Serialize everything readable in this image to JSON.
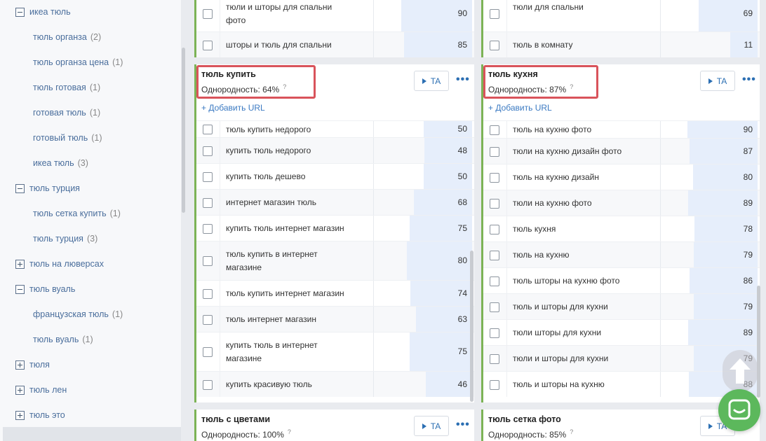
{
  "sidebar": {
    "items": [
      {
        "type": "parent",
        "state": "minus",
        "label": "икеа тюль",
        "count": ""
      },
      {
        "type": "child",
        "label": "тюль органза",
        "count": "(2)"
      },
      {
        "type": "child",
        "label": "тюль органза цена",
        "count": "(1)"
      },
      {
        "type": "child",
        "label": "тюль готовая",
        "count": "(1)"
      },
      {
        "type": "child",
        "label": "готовая тюль",
        "count": "(1)"
      },
      {
        "type": "child",
        "label": "готовый тюль",
        "count": "(1)"
      },
      {
        "type": "child",
        "label": "икеа тюль",
        "count": "(3)"
      },
      {
        "type": "parent",
        "state": "minus",
        "label": "тюль турция",
        "count": ""
      },
      {
        "type": "child",
        "label": "тюль сетка купить",
        "count": "(1)"
      },
      {
        "type": "child",
        "label": "тюль турция",
        "count": "(3)"
      },
      {
        "type": "parent",
        "state": "plus",
        "label": "тюль на люверсах",
        "count": ""
      },
      {
        "type": "parent",
        "state": "minus",
        "label": "тюль вуаль",
        "count": ""
      },
      {
        "type": "child",
        "label": "французская тюль",
        "count": "(1)"
      },
      {
        "type": "child",
        "label": "тюль вуаль",
        "count": "(1)"
      },
      {
        "type": "parent",
        "state": "plus",
        "label": "тюля",
        "count": ""
      },
      {
        "type": "parent",
        "state": "plus",
        "label": "тюль лен",
        "count": ""
      },
      {
        "type": "parent",
        "state": "plus",
        "label": "тюль это",
        "count": ""
      }
    ]
  },
  "common": {
    "ta_label": "TA",
    "add_url": "+ Добавить URL",
    "more": "•••",
    "hint": "?"
  },
  "top_left": {
    "rows": [
      {
        "keyword": "тюли и шторы для спальни фото",
        "value": 90
      },
      {
        "keyword": "шторы и тюль для спальни",
        "value": 85
      }
    ]
  },
  "top_right": {
    "rows": [
      {
        "keyword": "тюли для спальни",
        "value": 69
      },
      {
        "keyword": "тюль в комнату",
        "value": 11
      }
    ]
  },
  "card_buy": {
    "title": "тюль купить",
    "homogeneity": "Однородность: 64%",
    "rows": [
      {
        "keyword": "тюль купить недорого",
        "value": 50
      },
      {
        "keyword": "купить тюль недорого",
        "value": 48
      },
      {
        "keyword": "купить тюль дешево",
        "value": 50
      },
      {
        "keyword": "интернет магазин тюль",
        "value": 68
      },
      {
        "keyword": "купить тюль интернет магазин",
        "value": 75
      },
      {
        "keyword": "тюль купить в интернет магазине",
        "value": 80
      },
      {
        "keyword": "тюль купить интернет магазин",
        "value": 74
      },
      {
        "keyword": "тюль интернет магазин",
        "value": 63
      },
      {
        "keyword": "купить тюль в интернет магазине",
        "value": 75
      },
      {
        "keyword": "купить красивую тюль",
        "value": 46
      }
    ]
  },
  "card_kitchen": {
    "title": "тюль кухня",
    "homogeneity": "Однородность: 87%",
    "rows": [
      {
        "keyword": "тюль на кухню фото",
        "value": 90
      },
      {
        "keyword": "тюли на кухню дизайн фото",
        "value": 87
      },
      {
        "keyword": "тюль на кухню дизайн",
        "value": 80
      },
      {
        "keyword": "тюли на кухню фото",
        "value": 89
      },
      {
        "keyword": "тюль кухня",
        "value": 78
      },
      {
        "keyword": "тюль на кухню",
        "value": 79
      },
      {
        "keyword": "тюль шторы на кухню фото",
        "value": 86
      },
      {
        "keyword": "тюль и шторы для кухни",
        "value": 79
      },
      {
        "keyword": "тюли шторы для кухни",
        "value": 89
      },
      {
        "keyword": "тюли и шторы для кухни",
        "value": 79
      },
      {
        "keyword": "тюль и шторы на кухню",
        "value": 88
      }
    ]
  },
  "card_flowers": {
    "title": "тюль с цветами",
    "homogeneity": "Однородность: 100%"
  },
  "card_mesh": {
    "title": "тюль сетка фото",
    "homogeneity": "Однородность: 85%"
  },
  "colors": {
    "accent_green": "#7cb356",
    "link_blue": "#2c6fb3",
    "highlight_red": "#d9535b",
    "bar_fill": "#e6eefb"
  },
  "icons": [
    "minus-box-icon",
    "plus-box-icon",
    "play-icon",
    "more-dots-icon",
    "question-icon",
    "arrow-up-icon",
    "chat-icon"
  ]
}
